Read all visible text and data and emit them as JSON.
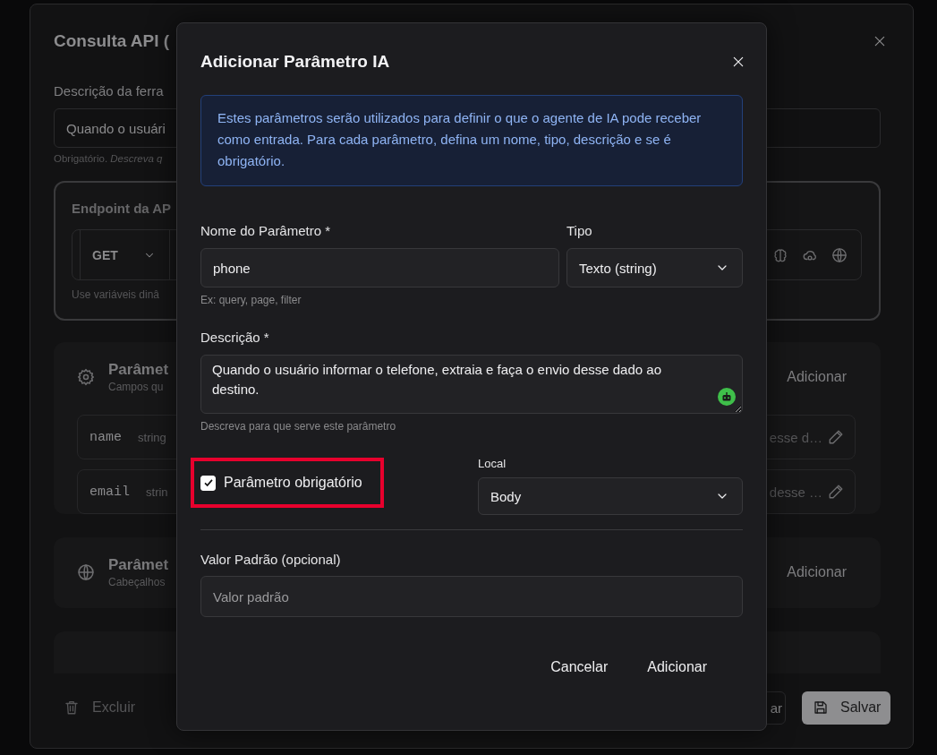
{
  "background_panel": {
    "title": "Consulta API (",
    "description_field": {
      "label": "Descrição da ferra",
      "value": "Quando o usuári",
      "hint": "Obrigatório. *Descreva q*"
    },
    "endpoint": {
      "title": "Endpoint da AP",
      "method": "GET",
      "hint": "Use variáveis dinâ"
    },
    "sections": [
      {
        "kind": "settings",
        "title": "Parâmet",
        "subtitle": "Campos qu",
        "action": "Adicionar",
        "rows": [
          {
            "name": "name",
            "type": "string",
            "description": "esse d…"
          },
          {
            "name": "email",
            "type": "strin",
            "description": "desse …"
          }
        ]
      },
      {
        "kind": "web",
        "title": "Parâmet",
        "subtitle": "Cabeçalhos",
        "action": "Adicionar"
      }
    ],
    "footer": {
      "delete": "Excluir",
      "cancel": "ar",
      "save": "Salvar"
    }
  },
  "modal": {
    "title": "Adicionar Parâmetro IA",
    "info": "Estes parâmetros serão utilizados para definir o que o agente de IA pode receber como entrada. Para cada parâmetro, defina um nome, tipo, descrição e se é obrigatório.",
    "name_field": {
      "label": "Nome do Parâmetro *",
      "value": "phone",
      "hint": "Ex: query, page, filter"
    },
    "type_field": {
      "label": "Tipo",
      "value": "Texto (string)"
    },
    "description_field": {
      "label": "Descrição *",
      "value": "Quando o usuário informar o telefone, extraia e faça o envio desse dado ao destino.",
      "hint": "Descreva para que serve este parâmetro"
    },
    "required": {
      "label": "Parâmetro obrigatório",
      "checked": true,
      "highlighted": true
    },
    "location_field": {
      "label": "Local",
      "value": "Body"
    },
    "default_field": {
      "label": "Valor Padrão (opcional)",
      "placeholder": "Valor padrão"
    },
    "buttons": [
      {
        "label": "Cancelar",
        "kind": "text"
      },
      {
        "label": "Adicionar",
        "kind": "text"
      }
    ]
  }
}
